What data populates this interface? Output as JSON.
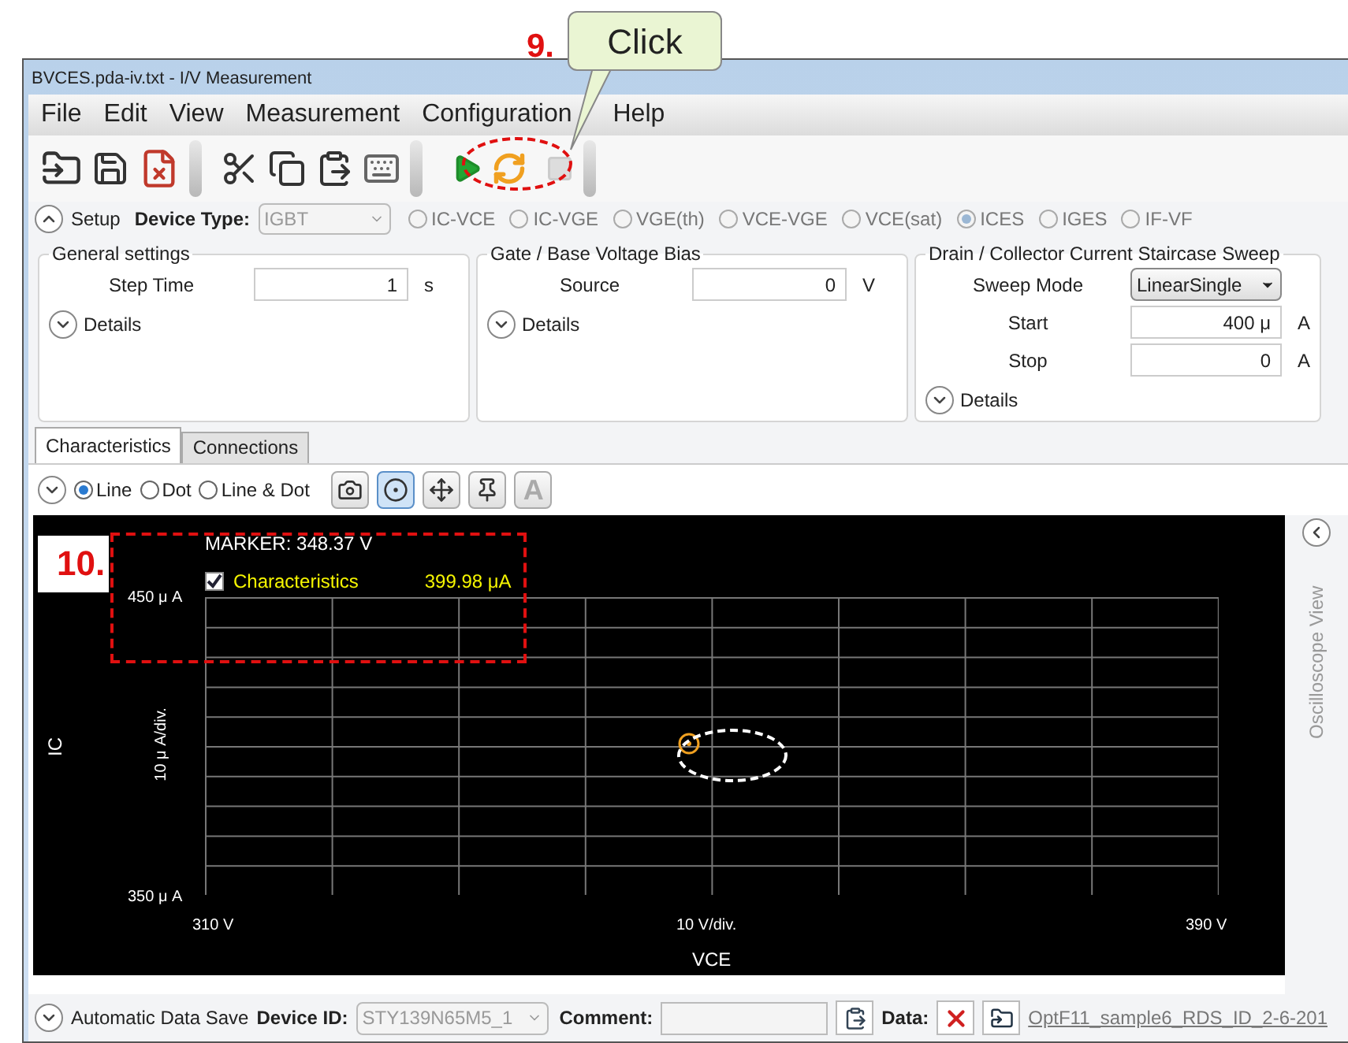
{
  "annotations": [
    {
      "kind": "callout",
      "label": "9.",
      "text": "Click"
    },
    {
      "kind": "box",
      "label": "10."
    }
  ],
  "window": {
    "title": "BVCES.pda-iv.txt - I/V Measurement"
  },
  "menu": [
    "File",
    "Edit",
    "View",
    "Measurement",
    "Configuration",
    "Help"
  ],
  "setup": {
    "label": "Setup",
    "expanded": true,
    "device_type_label": "Device Type:",
    "device_type": {
      "value": "IGBT",
      "disabled": true
    },
    "modes": [
      {
        "label": "IC-VCE",
        "selected": false
      },
      {
        "label": "IC-VGE",
        "selected": false
      },
      {
        "label": "VGE(th)",
        "selected": false
      },
      {
        "label": "VCE-VGE",
        "selected": false
      },
      {
        "label": "VCE(sat)",
        "selected": false
      },
      {
        "label": "ICES",
        "selected": true
      },
      {
        "label": "IGES",
        "selected": false
      },
      {
        "label": "IF-VF",
        "selected": false
      }
    ]
  },
  "groups": [
    {
      "title": "General settings",
      "fields": [
        {
          "kind": "input",
          "label": "Step Time",
          "value": "1",
          "unit": "s"
        }
      ],
      "details": {
        "label": "Details",
        "expanded": false
      }
    },
    {
      "title": "Gate / Base Voltage Bias",
      "fields": [
        {
          "kind": "input",
          "label": "Source",
          "value": "0",
          "unit": "V"
        }
      ],
      "details": {
        "label": "Details",
        "expanded": false
      }
    },
    {
      "title": "Drain / Collector Current Staircase Sweep",
      "fields": [
        {
          "kind": "select",
          "label": "Sweep Mode",
          "value": "LinearSingle"
        },
        {
          "kind": "input",
          "label": "Start",
          "value": "400 μ",
          "unit": "A"
        },
        {
          "kind": "input",
          "label": "Stop",
          "value": "0",
          "unit": "A"
        }
      ],
      "details": {
        "label": "Details",
        "expanded": false
      }
    }
  ],
  "tabs": [
    {
      "label": "Characteristics",
      "selected": true
    },
    {
      "label": "Connections",
      "selected": false
    }
  ],
  "plot_toolbar": {
    "expanded": false,
    "styles": [
      {
        "label": "Line",
        "selected": true
      },
      {
        "label": "Dot",
        "selected": false
      },
      {
        "label": "Line & Dot",
        "selected": false
      }
    ],
    "tools": [
      {
        "kind": "camera",
        "on": false
      },
      {
        "kind": "marker",
        "on": true
      },
      {
        "kind": "pan",
        "on": false
      },
      {
        "kind": "pin",
        "on": false
      },
      {
        "kind": "text",
        "label": "A",
        "on": false
      }
    ]
  },
  "plot": {
    "marker_label": "MARKER:",
    "marker_value": "348.37 V",
    "legend": {
      "label": "Characteristics",
      "checked": true,
      "value": "399.98 μA"
    },
    "y_top": "450 μ A",
    "y_bottom": "350 μ A",
    "ylabel": "IC",
    "ydiv": "10 μ A/div.",
    "x_left": "310 V",
    "xdiv": "10 V/div.",
    "x_right": "390 V",
    "xlabel": "VCE"
  },
  "side_panel": {
    "title": "Oscilloscope View",
    "expanded": false
  },
  "bottom": {
    "autosave": {
      "label": "Automatic Data Save",
      "expanded": false
    },
    "device_id_label": "Device ID:",
    "device_id": {
      "value": "STY139N65M5_1",
      "disabled": true
    },
    "comment_label": "Comment:",
    "data_label": "Data:",
    "file": "OptF11_sample6_RDS_ID_2-6-201"
  }
}
